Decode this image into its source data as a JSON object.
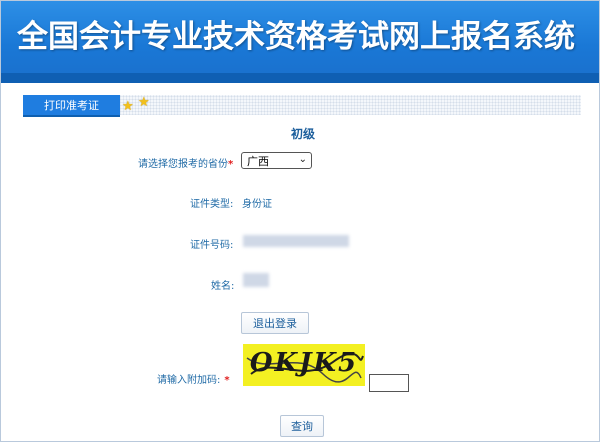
{
  "header": {
    "title": "全国会计专业技术资格考试网上报名系统"
  },
  "tab": {
    "label": "打印准考证"
  },
  "level": "初级",
  "form": {
    "province_label": "请选择您报考的省份",
    "province_required": "*",
    "province_value": "广西",
    "id_type_label": "证件类型:",
    "id_type_value": "身份证",
    "id_number_label": "证件号码:",
    "name_label": "姓名:",
    "logout_button": "退出登录",
    "captcha_label": "请输入附加码:",
    "captcha_required": "*",
    "captcha_text": "OKJK5",
    "query_button": "查询"
  },
  "colors": {
    "header": "#1a78d6",
    "tab": "#1f7de0",
    "label": "#1f6aa6",
    "required": "#e02020",
    "captcha_bg": "#f3f022"
  }
}
